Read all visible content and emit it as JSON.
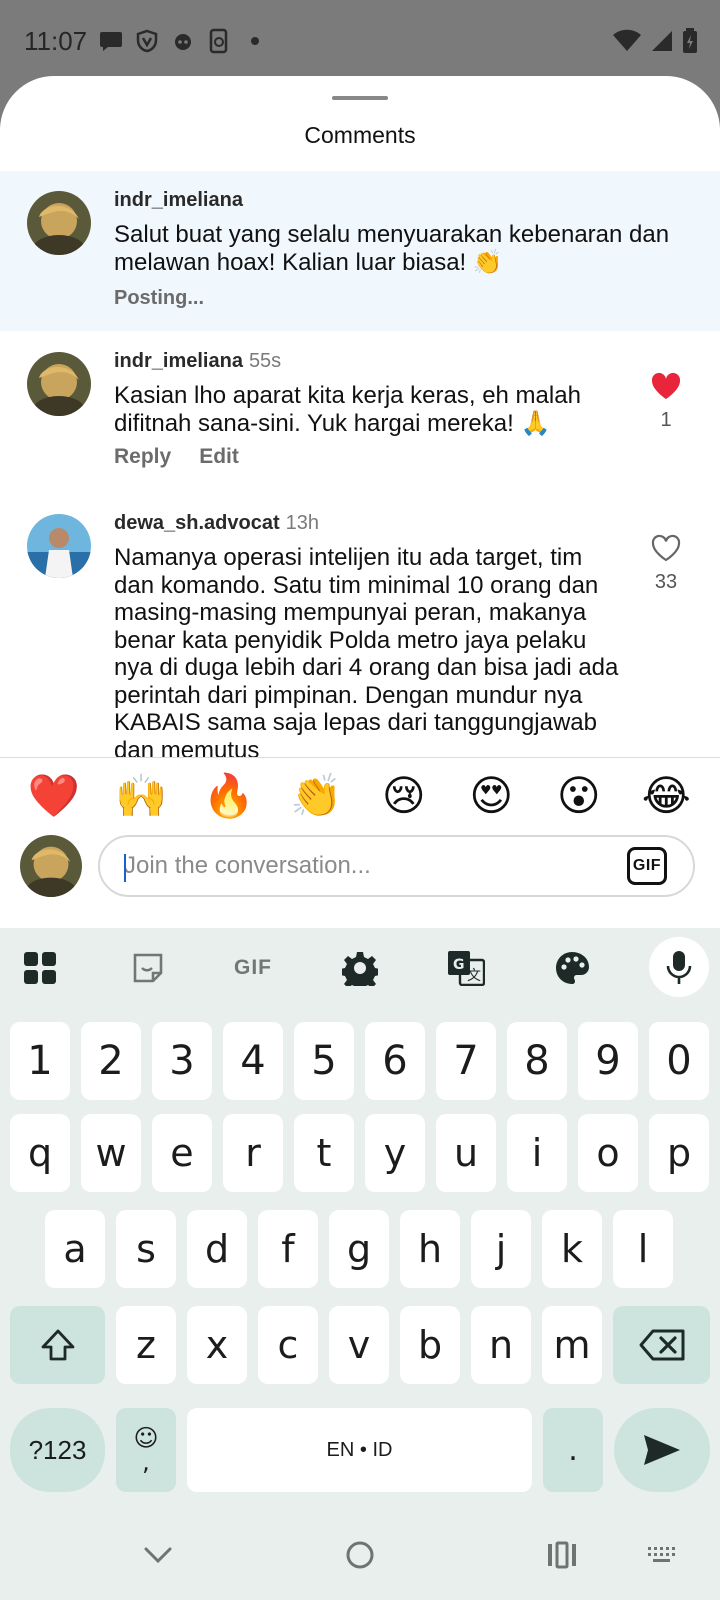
{
  "status_bar": {
    "time": "11:07",
    "left_icons": [
      "chat-bubble-icon",
      "shield-icon",
      "alien-icon",
      "phone-sync-icon",
      "dot-icon"
    ],
    "right_icons": [
      "wifi-icon",
      "cell-signal-icon",
      "battery-charging-icon"
    ]
  },
  "sheet": {
    "title": "Comments"
  },
  "comments": [
    {
      "username": "indr_imeliana",
      "time": "",
      "text": "Salut buat yang selalu menyuarakan kebenaran dan melawan hoax! Kalian luar biasa! 👏",
      "status": "Posting..."
    },
    {
      "username": "indr_imeliana",
      "time": "55s",
      "text": "Kasian lho aparat kita kerja keras, eh malah difitnah sana-sini. Yuk hargai mereka! 🙏",
      "reply_label": "Reply",
      "edit_label": "Edit",
      "likes": "1",
      "liked": true
    },
    {
      "username": "dewa_sh.advocat",
      "time": "13h",
      "text": "Namanya operasi intelijen itu ada target, tim dan komando. Satu tim minimal 10 orang dan masing-masing mempunyai peran, makanya benar kata penyidik Polda metro jaya pelaku nya di duga lebih dari 4 orang dan bisa jadi ada perintah dari pimpinan. Dengan mundur nya KABAIS sama saja lepas dari tanggungjawab dan memutus",
      "likes": "33",
      "liked": false
    }
  ],
  "reactions": [
    "❤️",
    "🙌",
    "🔥",
    "👏",
    "😢",
    "😍",
    "😮",
    "😂"
  ],
  "input": {
    "placeholder": "Join the conversation...",
    "gif_label": "GIF"
  },
  "keyboard": {
    "toolbar_icons": [
      "apps-grid-icon",
      "sticker-icon",
      "gif-icon",
      "settings-gear-icon",
      "translate-icon",
      "palette-icon",
      "mic-icon"
    ],
    "toolbar_gif_label": "GIF",
    "row_numbers": [
      "1",
      "2",
      "3",
      "4",
      "5",
      "6",
      "7",
      "8",
      "9",
      "0"
    ],
    "row1": [
      "q",
      "w",
      "e",
      "r",
      "t",
      "y",
      "u",
      "i",
      "o",
      "p"
    ],
    "row2": [
      "a",
      "s",
      "d",
      "f",
      "g",
      "h",
      "j",
      "k",
      "l"
    ],
    "row3": [
      "z",
      "x",
      "c",
      "v",
      "b",
      "n",
      "m"
    ],
    "symbols_label": "?123",
    "emoji_key_top": "☺",
    "emoji_key_bottom": ",",
    "space_label": "EN • ID",
    "period_label": "."
  },
  "nav_bar": {
    "icons": [
      "chevron-down-icon",
      "home-circle-icon",
      "recents-icon",
      "keyboard-switch-icon"
    ]
  },
  "colors": {
    "heart_red": "#e8253a",
    "pending_bg": "#f0f7fd",
    "keyboard_bg": "#e8efed",
    "function_key": "#cde4de"
  }
}
